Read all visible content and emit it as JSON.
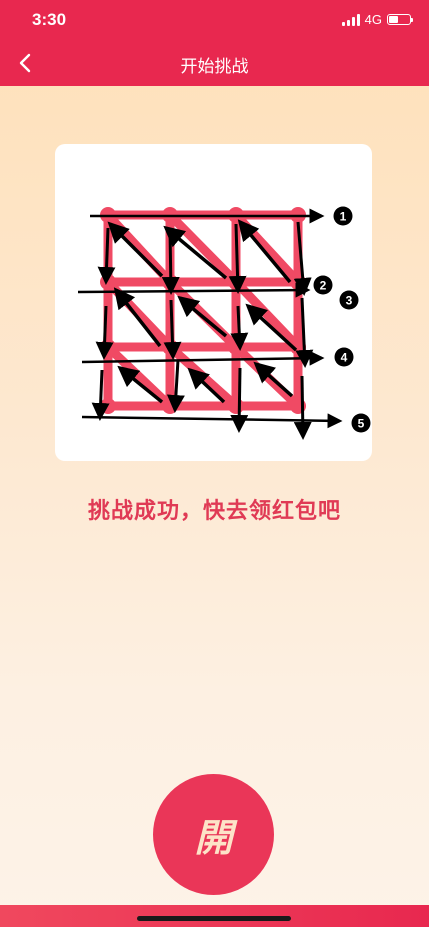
{
  "status_bar": {
    "time": "3:30",
    "network": "4G",
    "signal_icon": "signal-bars-icon",
    "battery_icon": "battery-icon",
    "battery_level": 0.45
  },
  "nav": {
    "title": "开始挑战",
    "back_icon": "chevron-left-icon"
  },
  "puzzle": {
    "grid_size": "4x4",
    "line_color": "#f04a64",
    "arrow_color": "#000000",
    "step_labels": [
      "1",
      "2",
      "3",
      "4",
      "5"
    ]
  },
  "message": {
    "success_text": "挑战成功，快去领红包吧"
  },
  "open_button": {
    "label": "開",
    "color": "#ea3658"
  },
  "colors": {
    "brand": "#e8284f",
    "text_accent": "#e03a55"
  }
}
